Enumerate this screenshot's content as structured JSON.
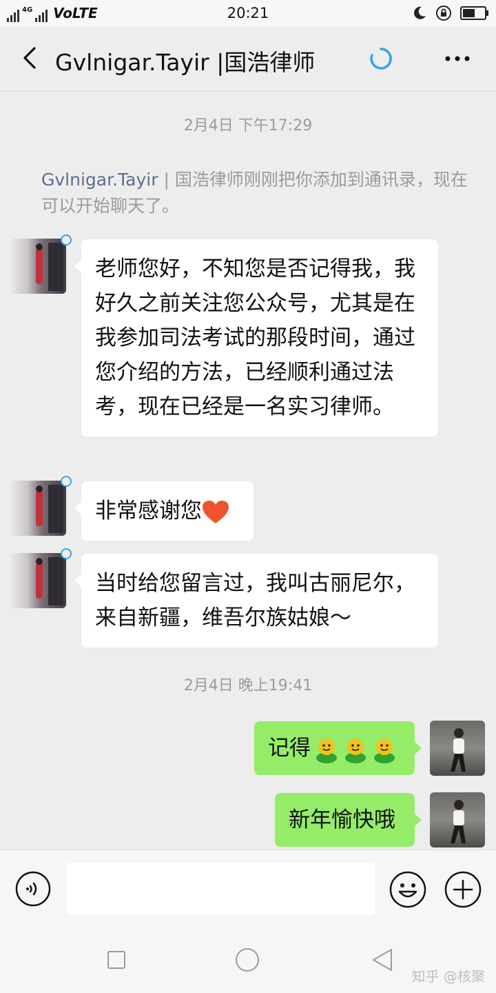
{
  "status_bar": {
    "network": "4G",
    "carrier": "VoLTE",
    "time": "20:21",
    "battery_level": 0.65
  },
  "header": {
    "title": "Gvlnigar.Tayir |国浩律师"
  },
  "messages": [
    {
      "type": "time",
      "text": "2月4日 下午17:29"
    },
    {
      "type": "system",
      "name": "Gvlnigar.Tayir",
      "text": " | 国浩律师刚刚把你添加到通讯录，现在可以开始聊天了。"
    },
    {
      "type": "received",
      "text": "老师您好，不知您是否记得我，我好久之前关注您公众号，尤其是在我参加司法考试的那段时间，通过您介绍的方法，已经顺利通过法考，现在已经是一名实习律师。"
    },
    {
      "type": "received",
      "text": "非常感谢您",
      "emoji": "heart-emoji"
    },
    {
      "type": "received",
      "text": "当时给您留言过，我叫古丽尼尔，来自新疆，维吾尔族姑娘～"
    },
    {
      "type": "time",
      "text": "2月4日 晚上19:41"
    },
    {
      "type": "sent",
      "text": "记得",
      "emoji": "sprout-emoji x3"
    },
    {
      "type": "sent",
      "text": "新年愉快哦"
    }
  ],
  "input": {
    "value": "",
    "placeholder": ""
  },
  "watermark": "知乎 @核聚",
  "colors": {
    "background": "#ededed",
    "sent_bubble": "#95ec69",
    "received_bubble": "#ffffff",
    "name_link": "#5a6e91"
  }
}
